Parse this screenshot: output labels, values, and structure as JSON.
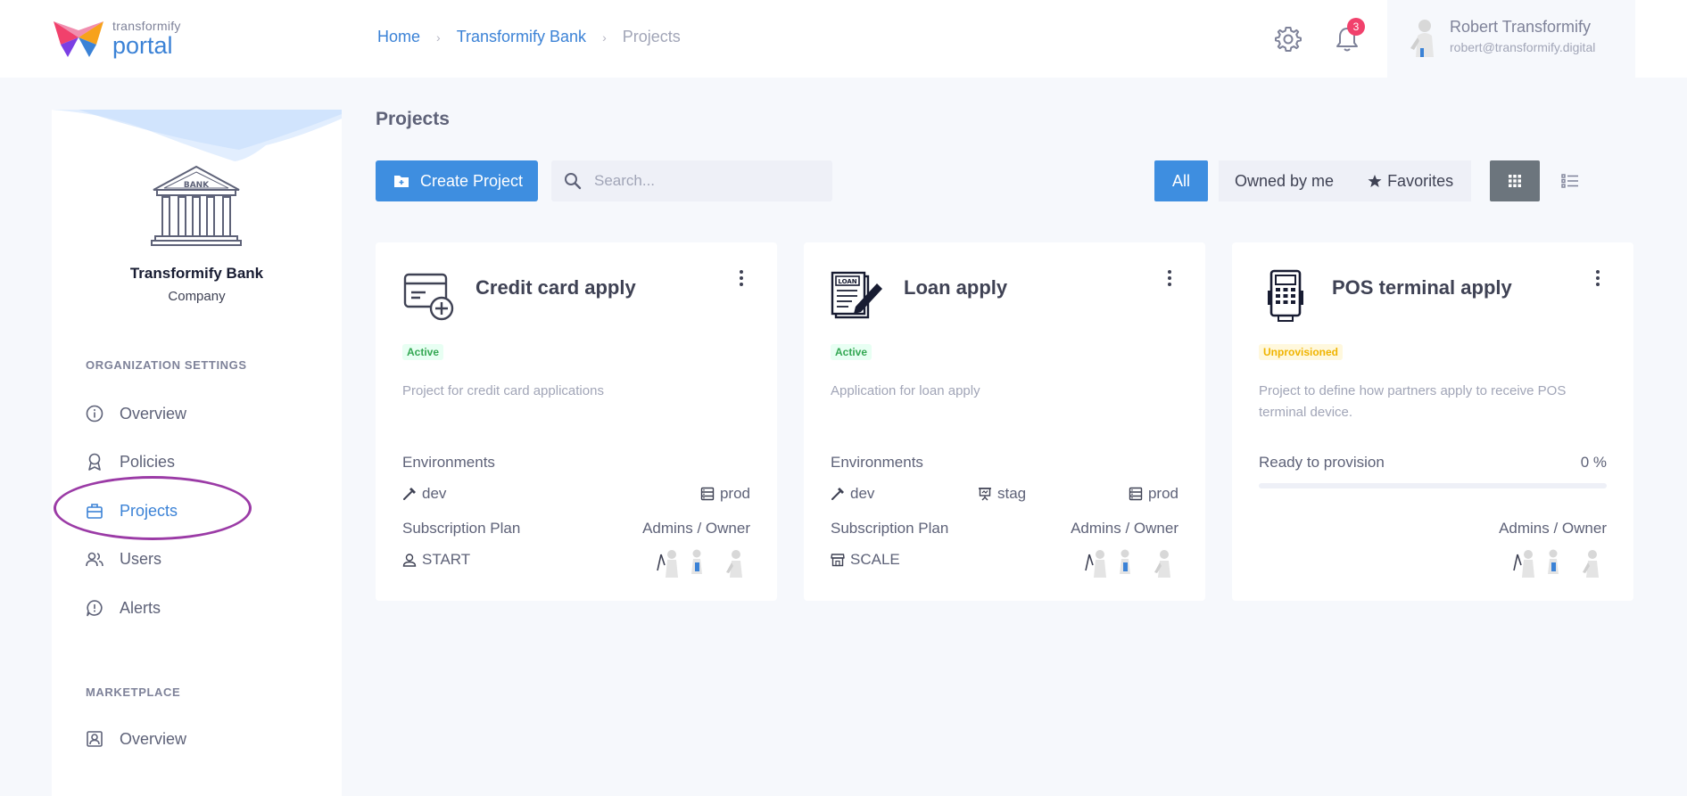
{
  "header": {
    "logo_small": "transformify",
    "logo_big": "portal",
    "breadcrumb": {
      "home": "Home",
      "bank": "Transformify Bank",
      "current": "Projects",
      "separator": "›"
    },
    "notifications_count": "3",
    "user_name": "Robert Transformify",
    "user_email": "robert@transformify.digital"
  },
  "sidebar": {
    "company_name": "Transformify Bank",
    "company_type": "Company",
    "bank_logo_text": "BANK",
    "org_section": "ORGANIZATION SETTINGS",
    "items": [
      {
        "label": "Overview",
        "icon": "info-icon"
      },
      {
        "label": "Policies",
        "icon": "badge-icon"
      },
      {
        "label": "Projects",
        "icon": "briefcase-icon"
      },
      {
        "label": "Users",
        "icon": "users-icon"
      },
      {
        "label": "Alerts",
        "icon": "alert-bubble-icon"
      }
    ],
    "marketplace_section": "MARKETPLACE",
    "marketplace_items": [
      {
        "label": "Overview",
        "icon": "portrait-icon"
      }
    ]
  },
  "main": {
    "title": "Projects",
    "create_label": "Create Project",
    "search_placeholder": "Search...",
    "filter_all": "All",
    "filter_owned": "Owned by me",
    "filter_favorites": "Favorites"
  },
  "cards": [
    {
      "title": "Credit card apply",
      "status": "Active",
      "description": "Project for credit card applications",
      "environments_label": "Environments",
      "environments": [
        "dev",
        "prod"
      ],
      "plan_label": "Subscription Plan",
      "plan": "START",
      "owners_label": "Admins / Owner"
    },
    {
      "title": "Loan apply",
      "status": "Active",
      "description": "Application for loan apply",
      "environments_label": "Environments",
      "environments": [
        "dev",
        "stag",
        "prod"
      ],
      "plan_label": "Subscription Plan",
      "plan": "SCALE",
      "owners_label": "Admins / Owner",
      "icon_text": "LOAN"
    },
    {
      "title": "POS terminal apply",
      "status": "Unprovisioned",
      "description": "Project to define how partners apply to receive POS terminal device.",
      "provision_label": "Ready to provision",
      "provision_percent": "0 %",
      "provision_value": 0,
      "owners_label": "Admins / Owner"
    }
  ],
  "colors": {
    "accent": "#3e8ee0",
    "active_badge": "#34a853",
    "unprovisioned_badge": "#f0b400",
    "highlight": "#9b3ba6",
    "notification": "#f1416c"
  }
}
